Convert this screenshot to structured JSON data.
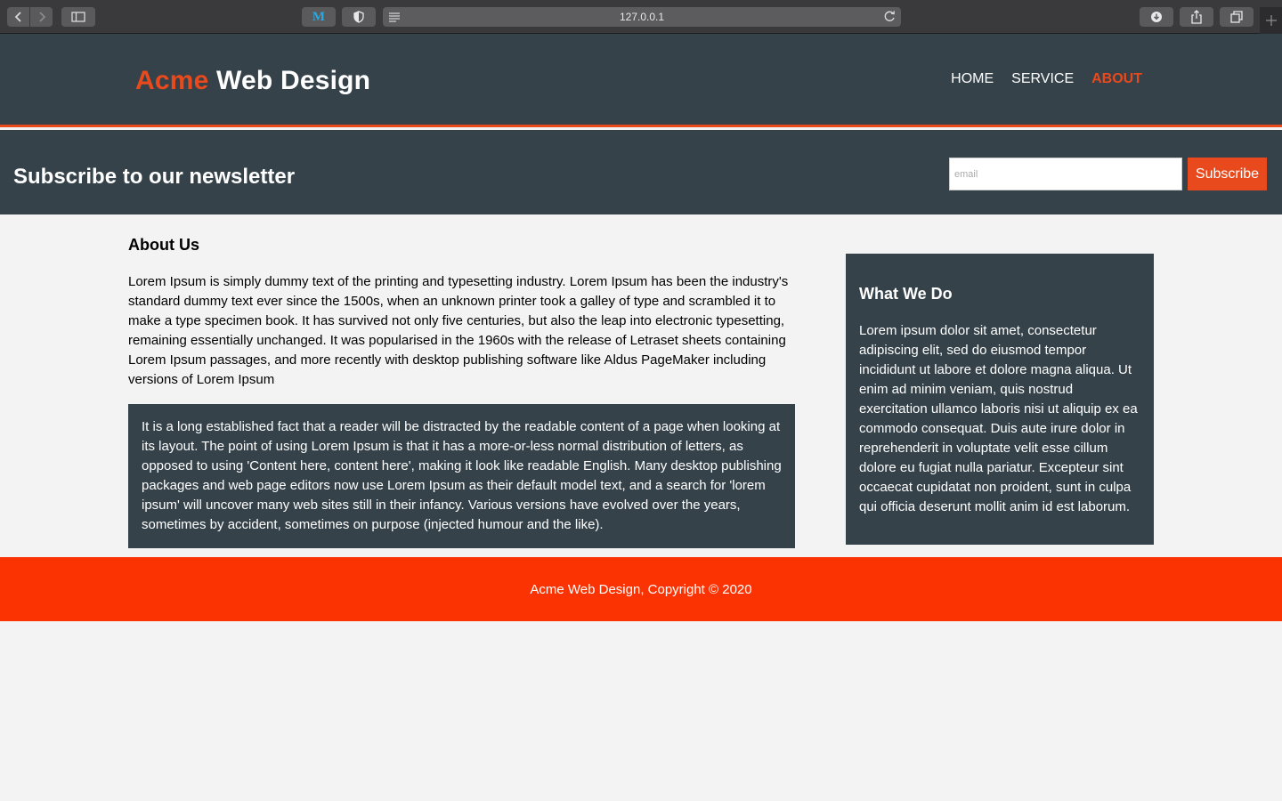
{
  "browser": {
    "url": "127.0.0.1",
    "ext_m_label": "M"
  },
  "header": {
    "logo_highlight": "Acme",
    "logo_rest": " Web Design",
    "nav": [
      {
        "label": "HOME"
      },
      {
        "label": "SERVICE"
      },
      {
        "label": "ABOUT",
        "current": true
      }
    ]
  },
  "newsletter": {
    "title": "Subscribe to our newsletter",
    "email_placeholder": "email",
    "button_label": "Subscribe"
  },
  "main": {
    "title": "About Us",
    "intro": "Lorem Ipsum is simply dummy text of the printing and typesetting industry. Lorem Ipsum has been the industry's standard dummy text ever since the 1500s, when an unknown printer took a galley of type and scrambled it to make a type specimen book. It has survived not only five centuries, but also the leap into electronic typesetting, remaining essentially unchanged. It was popularised in the 1960s with the release of Letraset sheets containing Lorem Ipsum passages, and more recently with desktop publishing software like Aldus PageMaker including versions of Lorem Ipsum",
    "dark_box_text": "It is a long established fact that a reader will be distracted by the readable content of a page when looking at its layout. The point of using Lorem Ipsum is that it has a more-or-less normal distribution of letters, as opposed to using 'Content here, content here', making it look like readable English. Many desktop publishing packages and web page editors now use Lorem Ipsum as their default model text, and a search for 'lorem ipsum' will uncover many web sites still in their infancy. Various versions have evolved over the years, sometimes by accident, sometimes on purpose (injected humour and the like)."
  },
  "sidebar": {
    "title": "What We Do",
    "text": "Lorem ipsum dolor sit amet, consectetur adipiscing elit, sed do eiusmod tempor incididunt ut labore et dolore magna aliqua. Ut enim ad minim veniam, quis nostrud exercitation ullamco laboris nisi ut aliquip ex ea commodo consequat. Duis aute irure dolor in reprehenderit in voluptate velit esse cillum dolore eu fugiat nulla pariatur. Excepteur sint occaecat cupidatat non proident, sunt in culpa qui officia deserunt mollit anim id est laborum."
  },
  "footer": {
    "text": "Acme Web Design, Copyright © 2020"
  },
  "colors": {
    "dark": "#35424a",
    "accent": "#e8491d",
    "footer": "#fb3302"
  }
}
